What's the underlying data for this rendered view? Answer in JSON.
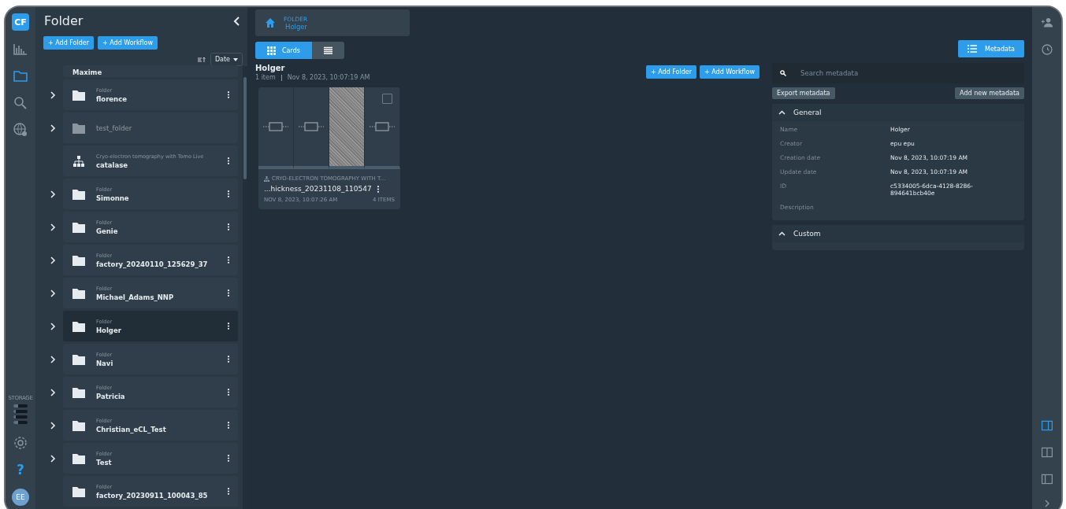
{
  "rail": {
    "logo": "CF",
    "nav": [
      {
        "kind": "chart",
        "selected": false
      },
      {
        "kind": "folder",
        "selected": true
      },
      {
        "kind": "search",
        "selected": false
      },
      {
        "kind": "globe",
        "selected": false
      }
    ],
    "storage_label": "STORAGE",
    "storage": [
      {
        "level": 0.35
      },
      {
        "level": 0.15
      },
      {
        "level": 0.15
      },
      {
        "level": 0.35
      }
    ],
    "help": "?",
    "avatar": "EE"
  },
  "panel": {
    "title": "Folder",
    "buttons": [
      "+ Add Folder",
      "+ Add Workflow"
    ],
    "sort": "Date",
    "items": [
      {
        "name": "Maxime",
        "partial": true,
        "expandable": false,
        "selected": false,
        "disabled": false
      },
      {
        "type": "Folder",
        "name": "florence",
        "expandable": true,
        "kind": "folder",
        "selected": false,
        "disabled": false
      },
      {
        "name": "test_folder",
        "expandable": true,
        "kind": "folder",
        "selected": false,
        "disabled": true
      },
      {
        "type": "Cryo-electron tomography with Tomo Live",
        "name": "catalase",
        "expandable": false,
        "kind": "workflow",
        "selected": false,
        "disabled": false
      },
      {
        "type": "Folder",
        "name": "Simonne",
        "expandable": true,
        "kind": "folder",
        "selected": false,
        "disabled": false
      },
      {
        "type": "Folder",
        "name": "Genie",
        "expandable": true,
        "kind": "folder",
        "selected": false,
        "disabled": false
      },
      {
        "type": "Folder",
        "name": "factory_20240110_125629_37",
        "expandable": true,
        "kind": "folder",
        "selected": false,
        "disabled": false
      },
      {
        "type": "Folder",
        "name": "Michael_Adams_NNP",
        "expandable": true,
        "kind": "folder",
        "selected": false,
        "disabled": false
      },
      {
        "type": "Folder",
        "name": "Holger",
        "expandable": true,
        "kind": "folder",
        "selected": true,
        "disabled": false
      },
      {
        "type": "Folder",
        "name": "Navi",
        "expandable": true,
        "kind": "folder",
        "selected": false,
        "disabled": false
      },
      {
        "type": "Folder",
        "name": "Patricia",
        "expandable": true,
        "kind": "folder",
        "selected": false,
        "disabled": false
      },
      {
        "type": "Folder",
        "name": "Christian_eCL_Test",
        "expandable": true,
        "kind": "folder",
        "selected": false,
        "disabled": false
      },
      {
        "type": "Folder",
        "name": "Test",
        "expandable": true,
        "kind": "folder",
        "selected": false,
        "disabled": false
      },
      {
        "type": "Folder",
        "name": "factory_20230911_100043_85",
        "expandable": false,
        "kind": "folder",
        "selected": false,
        "disabled": false
      }
    ]
  },
  "breadcrumb": {
    "label": "FOLDER",
    "name": "Holger"
  },
  "views": [
    {
      "label": "Cards",
      "kind": "grid",
      "selected": true
    },
    {
      "kind": "list",
      "selected": false
    }
  ],
  "metadata_button": "Metadata",
  "folder": {
    "title": "Holger",
    "count": "1 item",
    "date": "Nov 8, 2023, 10:07:19 AM",
    "buttons": [
      "+ Add Folder",
      "+ Add Workflow"
    ]
  },
  "card": {
    "strips": [
      {
        "kind": "node"
      },
      {
        "kind": "node"
      },
      {
        "kind": "image"
      },
      {
        "kind": "node"
      }
    ],
    "checked": false,
    "type": "CRYO-ELECTRON TOMOGRAPHY WITH T...",
    "name": "...hickness_20231108_110547",
    "date": "NOV 8, 2023, 10:07:26 AM",
    "items": "4 ITEMS"
  },
  "metadata": {
    "search_placeholder": "Search metadata",
    "export": "Export metadata",
    "add": "Add new metadata",
    "sections": [
      {
        "title": "General",
        "expanded": true,
        "fields": [
          {
            "label": "Name",
            "value": "Holger"
          },
          {
            "label": "Creator",
            "value": "epu epu"
          },
          {
            "label": "Creation date",
            "value": "Nov 8, 2023, 10:07:19 AM"
          },
          {
            "label": "Update date",
            "value": "Nov 8, 2023, 10:07:19 AM"
          },
          {
            "label": "ID",
            "value": "c5334005-6dca-4128-8286-894641bcb40e"
          },
          {
            "label": "Description"
          }
        ]
      },
      {
        "title": "Custom",
        "expanded": true
      }
    ]
  },
  "right_rail": {
    "top": [
      {
        "kind": "add-user"
      },
      {
        "kind": "clock"
      }
    ],
    "layouts": [
      {
        "kind": "right",
        "selected": true
      },
      {
        "kind": "split",
        "selected": false
      },
      {
        "kind": "left",
        "selected": false
      }
    ]
  }
}
